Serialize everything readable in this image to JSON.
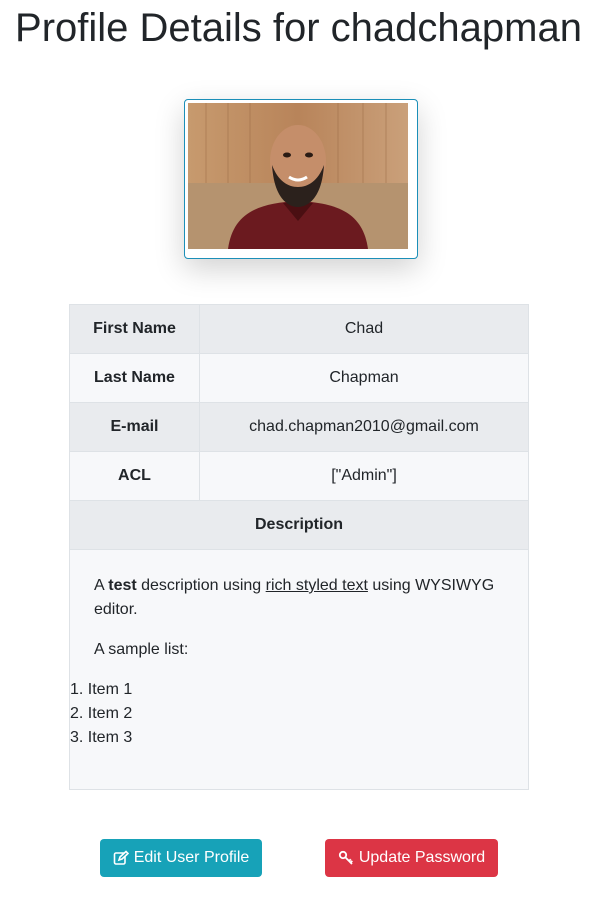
{
  "page": {
    "title": "Profile Details for chadchapman"
  },
  "profile": {
    "photo_icon": "user-photo",
    "fields": [
      {
        "label": "First Name",
        "value": "Chad"
      },
      {
        "label": "Last Name",
        "value": "Chapman"
      },
      {
        "label": "E-mail",
        "value": "chad.chapman2010@gmail.com"
      },
      {
        "label": "ACL",
        "value": "[\"Admin\"]"
      }
    ],
    "description": {
      "header": "Description",
      "p1_before": "A ",
      "p1_bold": "test",
      "p1_mid": " description using ",
      "p1_underline": "rich styled text",
      "p1_after": " using WYSIWYG editor.",
      "p2": "A sample list:",
      "list": [
        "1. Item 1",
        "2. Item 2",
        "3. Item 3"
      ]
    }
  },
  "actions": {
    "edit_label": "Edit User Profile",
    "edit_icon": "edit-icon",
    "password_label": "Update Password",
    "password_icon": "key-icon",
    "colors": {
      "edit": "#17a2b8",
      "password": "#dc3545"
    }
  }
}
